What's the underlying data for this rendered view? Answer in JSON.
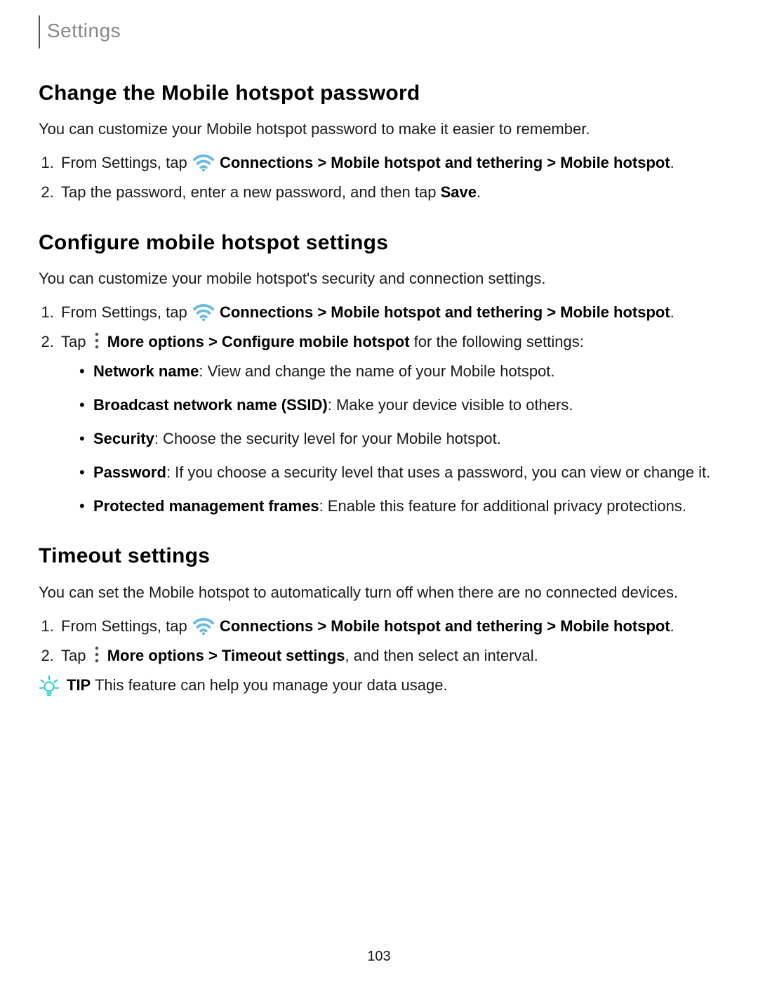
{
  "header": {
    "sectionLabel": "Settings"
  },
  "s1": {
    "title": "Change the Mobile hotspot password",
    "intro": "You can customize your Mobile hotspot password to make it easier to remember.",
    "step1_pre": "From Settings, tap ",
    "nav_conn": "Connections",
    "nav_tether": "Mobile hotspot and tethering",
    "nav_hotspot": "Mobile hotspot",
    "step2_a": "Tap the password, enter a new password, and then tap ",
    "step2_save": "Save",
    "step2_end": "."
  },
  "s2": {
    "title": "Configure mobile hotspot settings",
    "intro": "You can customize your mobile hotspot's security and connection settings.",
    "step1_pre": "From Settings, tap ",
    "step2_a": "Tap ",
    "step2_more": "More options",
    "step2_conf": "Configure mobile hotspot",
    "step2_tail": " for the following settings:",
    "bul1_b": "Network name",
    "bul1_t": ": View and change the name of your Mobile hotspot.",
    "bul2_b": "Broadcast network name (SSID)",
    "bul2_t": ": Make your device visible to others.",
    "bul3_b": "Security",
    "bul3_t": ": Choose the security level for your Mobile hotspot.",
    "bul4_b": "Password",
    "bul4_t": ": If you choose a security level that uses a password, you can view or change it.",
    "bul5_b": "Protected management frames",
    "bul5_t": ": Enable this feature for additional privacy protections."
  },
  "s3": {
    "title": "Timeout settings",
    "intro": "You can set the Mobile hotspot to automatically turn off when there are no connected devices.",
    "step1_pre": "From Settings, tap ",
    "step2_a": "Tap ",
    "step2_more": "More options",
    "step2_timeout": "Timeout settings",
    "step2_tail": ", and then select an interval."
  },
  "tip": {
    "label": "TIP",
    "text": " This feature can help you manage your data usage."
  },
  "page": {
    "number": "103"
  },
  "sep": " > "
}
